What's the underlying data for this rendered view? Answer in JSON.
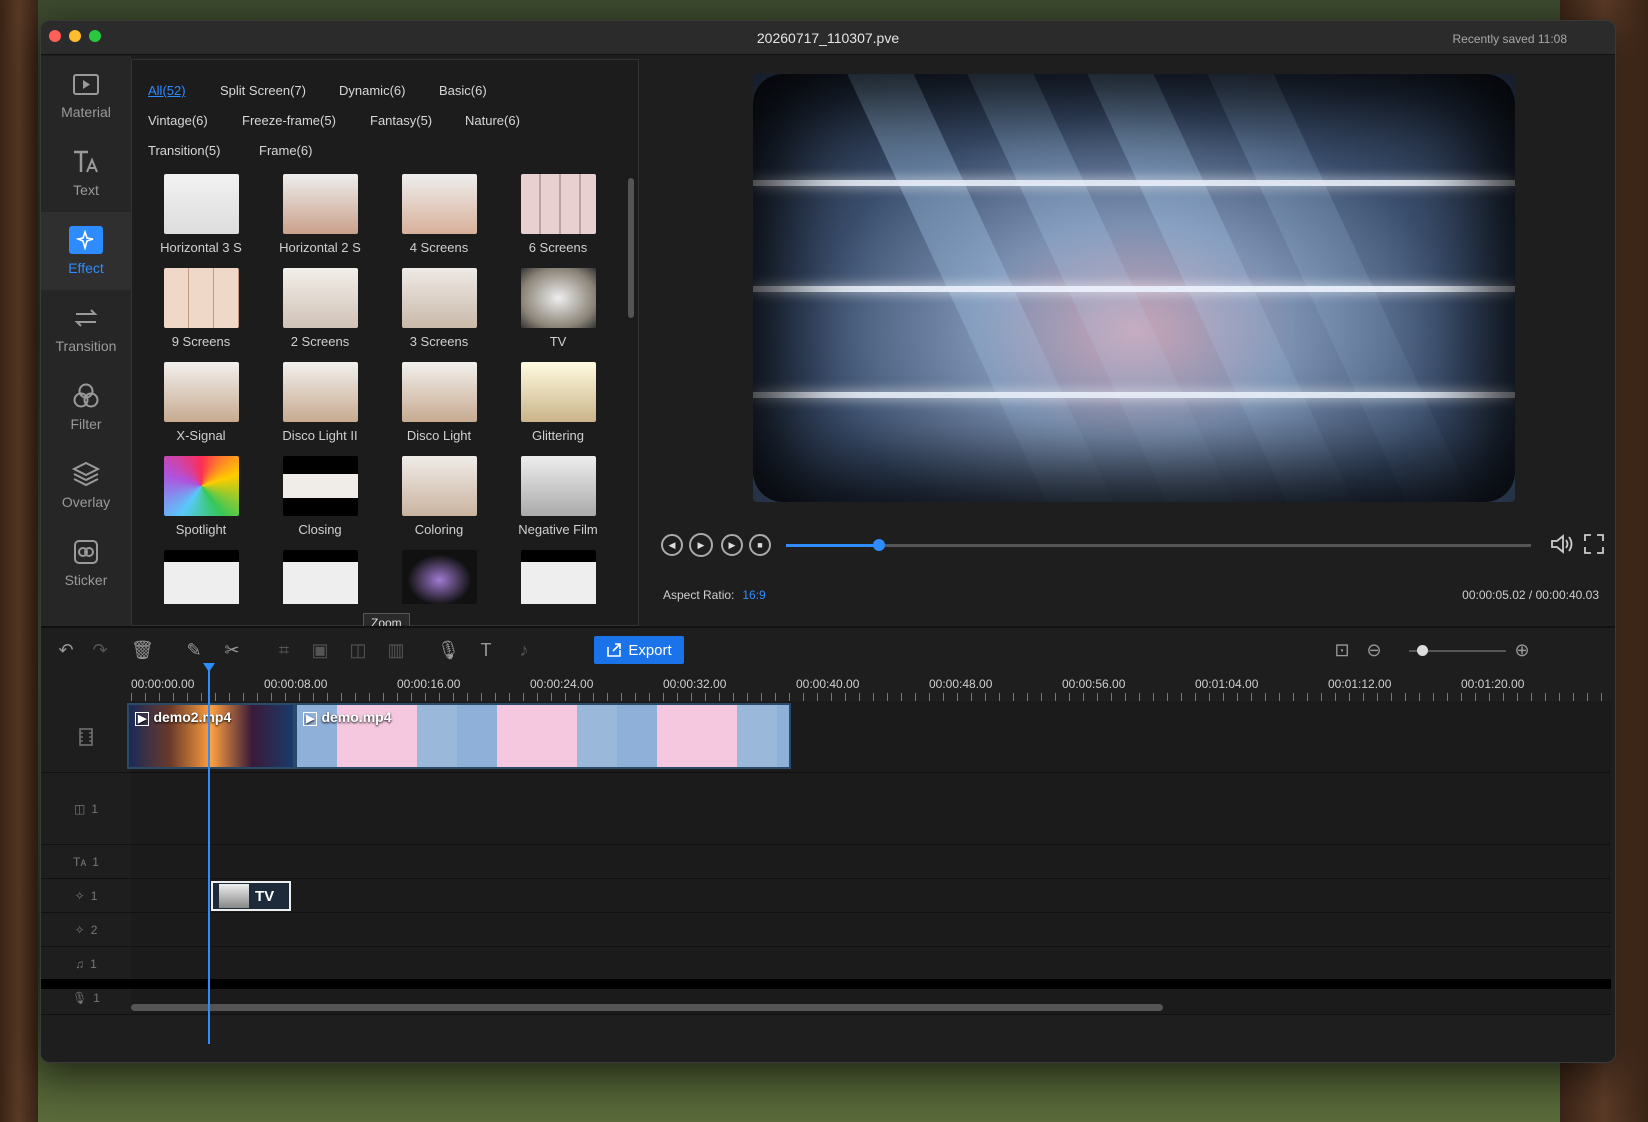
{
  "window": {
    "title": "20260717_110307.pve",
    "saved_status": "Recently saved  11:08"
  },
  "sidebar": {
    "items": [
      {
        "label": "Material",
        "icon": "folder-play-icon"
      },
      {
        "label": "Text",
        "icon": "text-icon"
      },
      {
        "label": "Effect",
        "icon": "sparkle-icon",
        "active": true
      },
      {
        "label": "Transition",
        "icon": "transition-icon"
      },
      {
        "label": "Filter",
        "icon": "filter-icon"
      },
      {
        "label": "Overlay",
        "icon": "layers-icon"
      },
      {
        "label": "Sticker",
        "icon": "sticker-icon"
      }
    ]
  },
  "effects_panel": {
    "categories": [
      "All(52)",
      "Split Screen(7)",
      "Dynamic(6)",
      "Basic(6)",
      "Vintage(6)",
      "Freeze-frame(5)",
      "Fantasy(5)",
      "Nature(6)",
      "Transition(5)",
      "Frame(6)"
    ],
    "selected_category": "All(52)",
    "items": [
      "Horizontal 3 S",
      "Horizontal 2 S",
      "4 Screens",
      "6 Screens",
      "9 Screens",
      "2 Screens",
      "3 Screens",
      "TV",
      "X-Signal",
      "Disco Light II",
      "Disco Light",
      "Glittering",
      "Spotlight",
      "Closing",
      "Coloring",
      "Negative Film"
    ],
    "tooltip": "Zoom"
  },
  "preview": {
    "progress": 0.125,
    "aspect_label": "Aspect Ratio:",
    "aspect_value": "16:9",
    "current_time": "00:00:05.02",
    "total_time": "00:00:40.03",
    "time_separator": "/"
  },
  "toolbar": {
    "export_label": "Export",
    "zoom_level": 0.1
  },
  "timeline": {
    "ruler": [
      "00:00:00.00",
      "00:00:08.00",
      "00:00:16.00",
      "00:00:24.00",
      "00:00:32.00",
      "00:00:40.00",
      "00:00:48.00",
      "00:00:56.00",
      "00:01:04.00",
      "00:01:12.00",
      "00:01:20.00"
    ],
    "clips": [
      {
        "name": "demo2.mp4"
      },
      {
        "name": "demo.mp4"
      }
    ],
    "effect_clip": "TV",
    "tracks": [
      {
        "icon": "pip-icon",
        "num": "1"
      },
      {
        "icon": "text-track-icon",
        "num": "1"
      },
      {
        "icon": "effect-track-icon",
        "num": "1"
      },
      {
        "icon": "effect-track-icon",
        "num": "2"
      },
      {
        "icon": "music-icon",
        "num": "1"
      },
      {
        "icon": "mic-icon",
        "num": "1"
      }
    ]
  },
  "colors": {
    "accent": "#2f8cff",
    "export": "#1a73e8"
  }
}
